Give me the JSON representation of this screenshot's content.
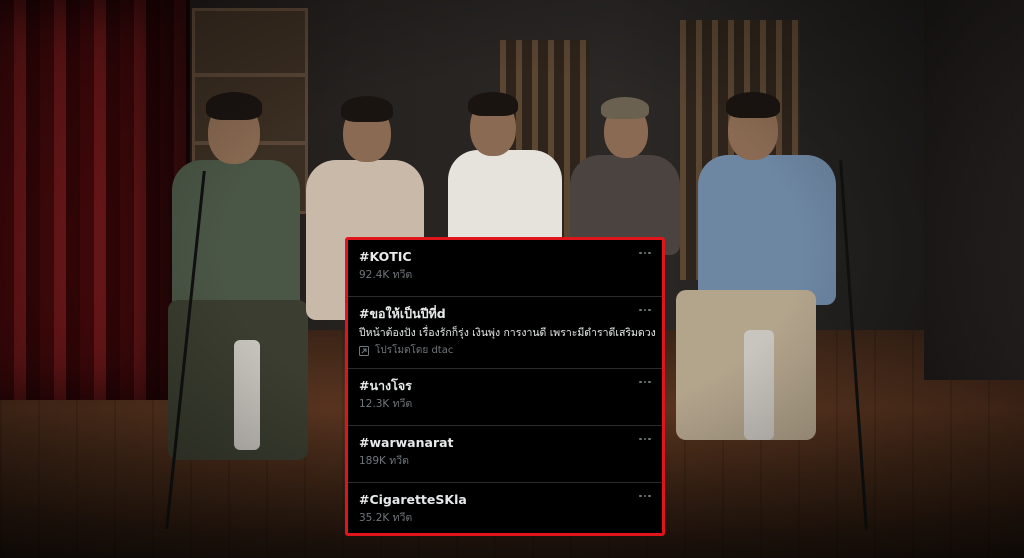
{
  "trends_panel": {
    "border_color": "#e0151b",
    "items": [
      {
        "tag": "#KOTIC",
        "count": "92.4K ทวีต"
      },
      {
        "tag": "#ขอให้เป็นปีที่d",
        "description": "ปีหน้าต้องปัง เรื่องรักก็รุ่ง เงินพุ่ง การงานดี เพราะมีดำราดีเสริมดวง",
        "promoted": "โปรโมตโดย dtac"
      },
      {
        "tag": "#นางโจร",
        "count": "12.3K ทวีต"
      },
      {
        "tag": "#warwanarat",
        "count": "189K ทวีต"
      },
      {
        "tag": "#CigaretteSKla",
        "count": "35.2K ทวีต"
      }
    ],
    "more_icon": "more-horizontal-icon",
    "promoted_icon": "promoted-arrow-icon"
  }
}
